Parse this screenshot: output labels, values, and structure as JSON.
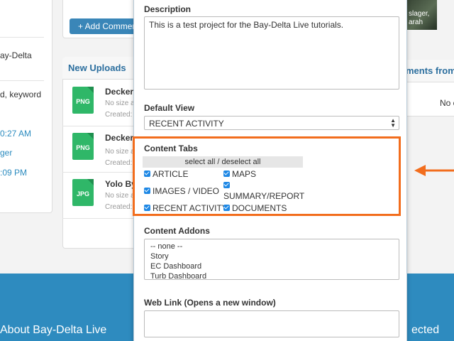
{
  "background": {
    "left": {
      "lines": [
        "ay-Delta",
        "d, keyword"
      ],
      "times": [
        "0:27 AM",
        ":09 PM"
      ],
      "user": "ger"
    },
    "add_comment_label": "+ Add Comment",
    "uploads": {
      "title": "New Uploads",
      "items": [
        {
          "name": "Decker",
          "type": "PNG",
          "size": "No size a",
          "created": "Created:"
        },
        {
          "name": "Decker",
          "type": "PNG",
          "size": "No size a",
          "created": "Created:"
        },
        {
          "name": "Yolo By",
          "type": "JPG",
          "size": "No size a",
          "created": "Created:"
        }
      ]
    },
    "comments": {
      "title": "ments from",
      "empty": "No c"
    },
    "photo_caption": [
      "slager,",
      "arah"
    ],
    "footer": {
      "left": "About Bay-Delta Live",
      "right": "ected"
    }
  },
  "modal": {
    "description": {
      "label": "Description",
      "value": "This is a test project for the Bay-Delta Live tutorials."
    },
    "default_view": {
      "label": "Default View",
      "selected": "RECENT ACTIVITY"
    },
    "content_tabs": {
      "label": "Content Tabs",
      "select_all": "select all / deselect all",
      "items": [
        {
          "label": "ARTICLE",
          "checked": true
        },
        {
          "label": "MAPS",
          "checked": true
        },
        {
          "label": "IMAGES / VIDEO",
          "checked": true
        },
        {
          "label": "SUMMARY/REPORT",
          "checked": true
        },
        {
          "label": "RECENT ACTIVITY",
          "checked": true
        },
        {
          "label": "DOCUMENTS",
          "checked": true
        }
      ]
    },
    "content_addons": {
      "label": "Content Addons",
      "options": [
        "-- none --",
        "Story",
        "EC Dashboard",
        "Turb Dashboard"
      ]
    },
    "web_link": {
      "label": "Web Link (Opens a new window)",
      "value": ""
    }
  },
  "colors": {
    "highlight": "#f26d1d",
    "footer": "#2e8bbf",
    "checkbox": "#1e88e5",
    "file_icon": "#2fb768"
  }
}
